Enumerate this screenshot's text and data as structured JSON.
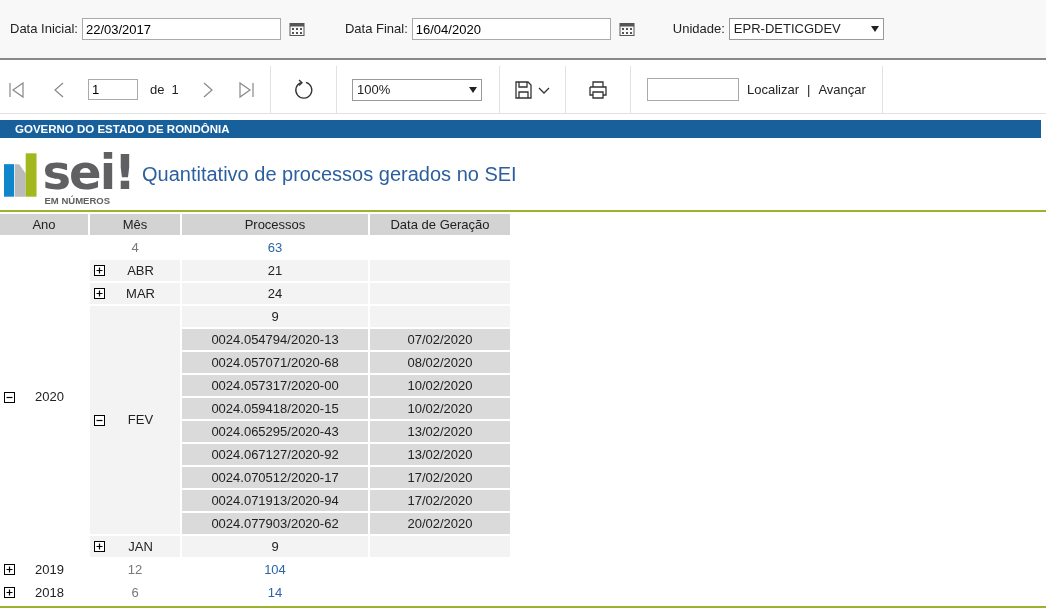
{
  "filters": {
    "start_label": "Data Inicial:",
    "start_value": "22/03/2017",
    "end_label": "Data Final:",
    "end_value": "16/04/2020",
    "unit_label": "Unidade:",
    "unit_value": "EPR-DETICGDEV"
  },
  "toolbar": {
    "page": "1",
    "of_label": "de",
    "page_count": "1",
    "zoom": "100%",
    "find_label": "Localizar",
    "separator": "|",
    "next_label": "Avançar"
  },
  "report": {
    "agency": "GOVERNO DO ESTADO DE RONDÔNIA",
    "logo_text": "sei!",
    "logo_subtitle": "EM NÚMEROS",
    "title": "Quantitativo de processos gerados no SEI"
  },
  "table": {
    "columns": [
      "Ano",
      "Mês",
      "Processos",
      "Data de Geração"
    ],
    "years": [
      {
        "year": "2020",
        "expanded": true,
        "month_count": "4",
        "total": "63",
        "months": [
          {
            "month": "ABR",
            "expanded": false,
            "total": "21"
          },
          {
            "month": "MAR",
            "expanded": false,
            "total": "24"
          },
          {
            "month": "FEV",
            "expanded": true,
            "total": "9",
            "processes": [
              {
                "number": "0024.054794/2020-13",
                "date": "07/02/2020"
              },
              {
                "number": "0024.057071/2020-68",
                "date": "08/02/2020"
              },
              {
                "number": "0024.057317/2020-00",
                "date": "10/02/2020"
              },
              {
                "number": "0024.059418/2020-15",
                "date": "10/02/2020"
              },
              {
                "number": "0024.065295/2020-43",
                "date": "13/02/2020"
              },
              {
                "number": "0024.067127/2020-92",
                "date": "13/02/2020"
              },
              {
                "number": "0024.070512/2020-17",
                "date": "17/02/2020"
              },
              {
                "number": "0024.071913/2020-94",
                "date": "17/02/2020"
              },
              {
                "number": "0024.077903/2020-62",
                "date": "20/02/2020"
              }
            ]
          },
          {
            "month": "JAN",
            "expanded": false,
            "total": "9"
          }
        ]
      },
      {
        "year": "2019",
        "expanded": false,
        "month_count": "12",
        "total": "104"
      },
      {
        "year": "2018",
        "expanded": false,
        "month_count": "6",
        "total": "14"
      }
    ]
  }
}
